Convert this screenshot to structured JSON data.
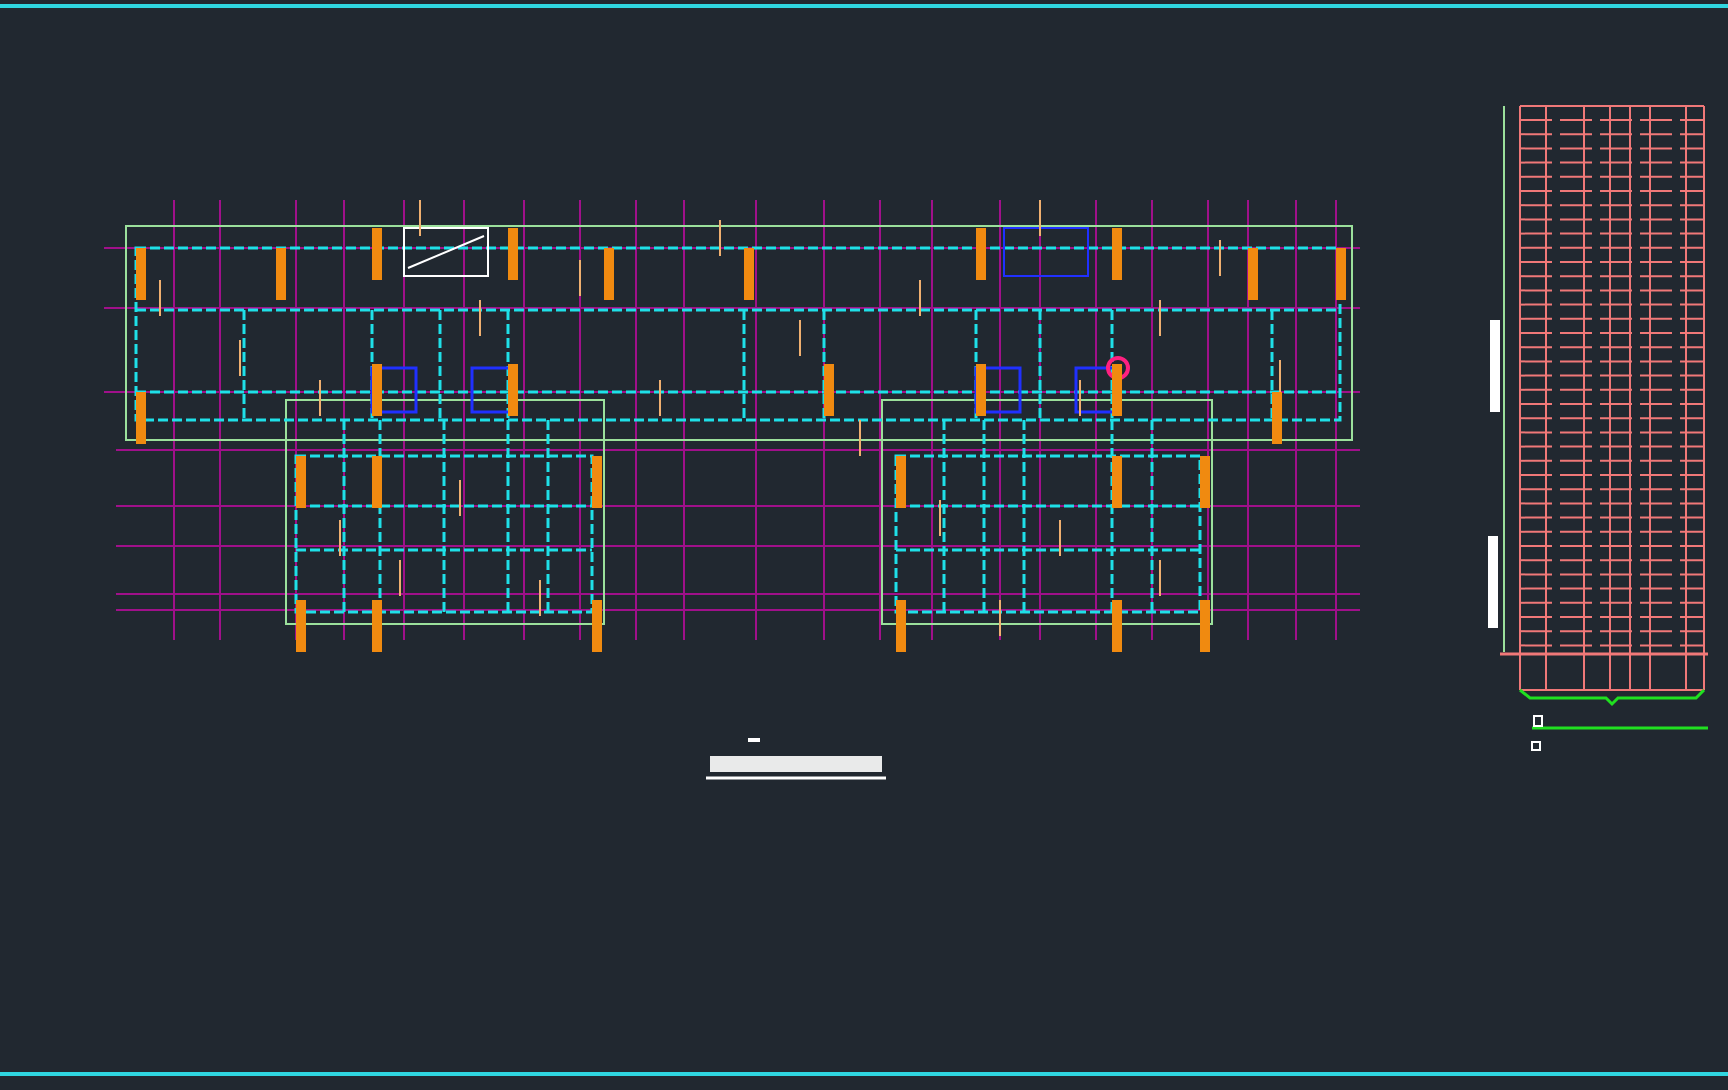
{
  "views": [
    {
      "kind": "floor-plan"
    },
    {
      "kind": "elevation"
    }
  ]
}
